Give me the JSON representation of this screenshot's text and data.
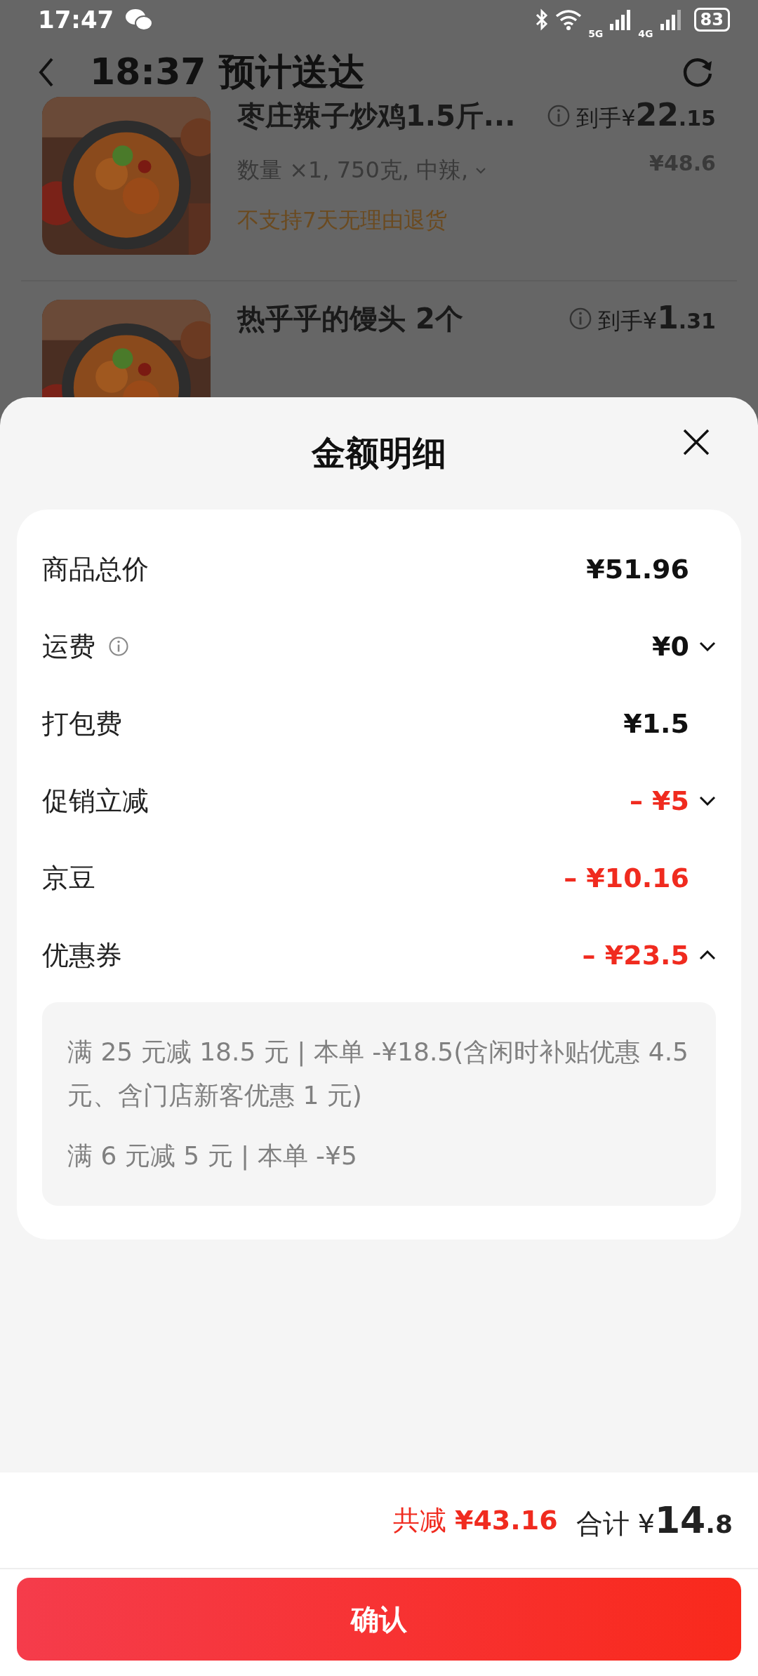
{
  "status_bar": {
    "time": "17:47",
    "network_1": "5G",
    "network_2": "4G",
    "battery": "83"
  },
  "header": {
    "title": "18:37 预计送达"
  },
  "items": [
    {
      "title": "枣庄辣子炒鸡1.5斤...",
      "price_label": "到手¥",
      "price_main": "22",
      "price_decimal": ".15",
      "specs": "数量 ×1, 750克, 中辣,",
      "original_price": "¥48.6",
      "notice": "不支持7天无理由退货"
    },
    {
      "title": "热乎乎的馒头  2个",
      "price_label": "到手¥",
      "price_main": "1",
      "price_decimal": ".31"
    }
  ],
  "sheet": {
    "title": "金额明细",
    "rows": [
      {
        "label": "商品总价",
        "value": "¥51.96",
        "kind": "normal",
        "info": false
      },
      {
        "label": "运费",
        "value": "¥0",
        "kind": "normal",
        "info": true,
        "expanded": false
      },
      {
        "label": "打包费",
        "value": "¥1.5",
        "kind": "normal",
        "info": false
      },
      {
        "label": "促销立减",
        "value": "– ¥5",
        "kind": "discount",
        "info": false,
        "expanded": false
      },
      {
        "label": "京豆",
        "value": "– ¥10.16",
        "kind": "discount",
        "info": false
      },
      {
        "label": "优惠券",
        "value": "– ¥23.5",
        "kind": "discount",
        "info": false,
        "expanded": true
      }
    ],
    "coupon_details": [
      "满 25 元减 18.5 元 | 本单 -¥18.5(含闲时补贴优惠 4.5 元、含门店新客优惠 1 元)",
      "满 6 元减 5 元 | 本单 -¥5"
    ],
    "summary": {
      "discount_label": "共减",
      "discount_value": "¥43.16",
      "total_label": "合计",
      "total_currency": "¥",
      "total_main": "14",
      "total_decimal": ".8"
    },
    "confirm_button": "确认"
  }
}
